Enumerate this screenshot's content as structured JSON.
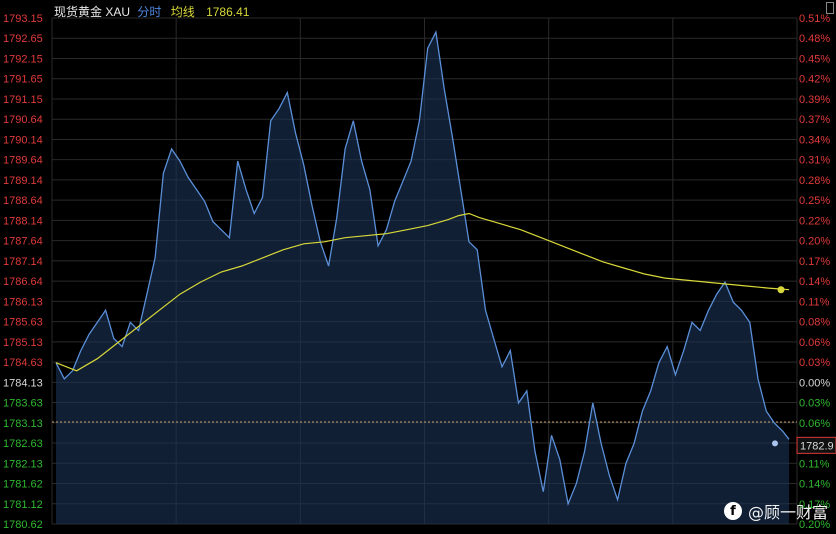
{
  "header": {
    "instrument": "现货黄金 XAU",
    "mode": "分时",
    "ma_label": "均线",
    "ma_value": "1786.41"
  },
  "colors": {
    "background": "#000000",
    "grid": "#2a2a2a",
    "price_line": "#5a8fd8",
    "area_fill": "#1a3357",
    "ma_line": "#d8d83a",
    "up_text": "#e03a3a",
    "down_text": "#2fb82f",
    "flat_text": "#d8d8d8",
    "ref_line": "#c9a26a"
  },
  "watermark": "@顾一财富",
  "chart_data": {
    "type": "line",
    "title": "",
    "xlabel": "",
    "ylabel": "",
    "ylim": [
      1780.6,
      1793.15
    ],
    "prev_close": 1784.13,
    "grid": true,
    "y_ticks_left": [
      "1793.15",
      "1792.65",
      "1792.15",
      "1791.65",
      "1791.15",
      "1790.64",
      "1790.14",
      "1789.64",
      "1789.14",
      "1788.64",
      "1788.14",
      "1787.64",
      "1787.14",
      "1786.64",
      "1786.13",
      "1785.63",
      "1785.13",
      "1784.63",
      "1784.13",
      "1783.63",
      "1783.13",
      "1782.63",
      "1782.13",
      "1781.62",
      "1781.12",
      "1780.62"
    ],
    "y_ticks_right": [
      "0.51%",
      "0.48%",
      "0.45%",
      "0.42%",
      "0.39%",
      "0.37%",
      "0.34%",
      "0.31%",
      "0.28%",
      "0.25%",
      "0.22%",
      "0.20%",
      "0.17%",
      "0.14%",
      "0.11%",
      "0.08%",
      "0.06%",
      "0.03%",
      "0.00%",
      "0.03%",
      "0.06%",
      "0.08%",
      "0.11%",
      "0.14%",
      "0.17%",
      "0.20%"
    ],
    "last_price_label": "1782.9",
    "series": [
      {
        "key": "price",
        "values": [
          [
            0,
            1784.6
          ],
          [
            8,
            1784.2
          ],
          [
            16,
            1784.4
          ],
          [
            24,
            1784.9
          ],
          [
            32,
            1785.3
          ],
          [
            40,
            1785.6
          ],
          [
            48,
            1785.9
          ],
          [
            56,
            1785.2
          ],
          [
            64,
            1785.0
          ],
          [
            72,
            1785.6
          ],
          [
            80,
            1785.4
          ],
          [
            88,
            1786.3
          ],
          [
            96,
            1787.2
          ],
          [
            104,
            1789.3
          ],
          [
            112,
            1789.9
          ],
          [
            120,
            1789.6
          ],
          [
            128,
            1789.2
          ],
          [
            136,
            1788.9
          ],
          [
            144,
            1788.6
          ],
          [
            152,
            1788.1
          ],
          [
            160,
            1787.9
          ],
          [
            168,
            1787.7
          ],
          [
            176,
            1789.6
          ],
          [
            184,
            1788.9
          ],
          [
            192,
            1788.3
          ],
          [
            200,
            1788.7
          ],
          [
            208,
            1790.6
          ],
          [
            216,
            1790.9
          ],
          [
            224,
            1791.3
          ],
          [
            232,
            1790.3
          ],
          [
            240,
            1789.5
          ],
          [
            248,
            1788.5
          ],
          [
            256,
            1787.6
          ],
          [
            264,
            1787.0
          ],
          [
            272,
            1788.2
          ],
          [
            280,
            1789.9
          ],
          [
            288,
            1790.6
          ],
          [
            296,
            1789.6
          ],
          [
            304,
            1788.9
          ],
          [
            312,
            1787.5
          ],
          [
            320,
            1787.9
          ],
          [
            328,
            1788.6
          ],
          [
            336,
            1789.1
          ],
          [
            344,
            1789.6
          ],
          [
            352,
            1790.6
          ],
          [
            360,
            1792.4
          ],
          [
            368,
            1792.8
          ],
          [
            376,
            1791.4
          ],
          [
            384,
            1790.2
          ],
          [
            392,
            1788.9
          ],
          [
            400,
            1787.6
          ],
          [
            408,
            1787.4
          ],
          [
            416,
            1785.9
          ],
          [
            424,
            1785.2
          ],
          [
            432,
            1784.5
          ],
          [
            440,
            1784.9
          ],
          [
            448,
            1783.6
          ],
          [
            456,
            1783.9
          ],
          [
            464,
            1782.4
          ],
          [
            472,
            1781.4
          ],
          [
            480,
            1782.8
          ],
          [
            488,
            1782.2
          ],
          [
            496,
            1781.1
          ],
          [
            504,
            1781.6
          ],
          [
            512,
            1782.4
          ],
          [
            520,
            1783.6
          ],
          [
            528,
            1782.6
          ],
          [
            536,
            1781.8
          ],
          [
            544,
            1781.2
          ],
          [
            552,
            1782.1
          ],
          [
            560,
            1782.6
          ],
          [
            568,
            1783.4
          ],
          [
            576,
            1783.9
          ],
          [
            584,
            1784.6
          ],
          [
            592,
            1785.0
          ],
          [
            600,
            1784.3
          ],
          [
            608,
            1784.9
          ],
          [
            616,
            1785.6
          ],
          [
            624,
            1785.4
          ],
          [
            632,
            1785.9
          ],
          [
            640,
            1786.3
          ],
          [
            648,
            1786.6
          ],
          [
            656,
            1786.1
          ],
          [
            664,
            1785.9
          ],
          [
            672,
            1785.6
          ],
          [
            680,
            1784.2
          ],
          [
            688,
            1783.4
          ],
          [
            696,
            1783.1
          ],
          [
            704,
            1782.9
          ],
          [
            710,
            1782.7
          ]
        ]
      },
      {
        "key": "average",
        "values": [
          [
            0,
            1784.6
          ],
          [
            20,
            1784.4
          ],
          [
            40,
            1784.7
          ],
          [
            60,
            1785.1
          ],
          [
            80,
            1785.5
          ],
          [
            100,
            1785.9
          ],
          [
            120,
            1786.3
          ],
          [
            140,
            1786.6
          ],
          [
            160,
            1786.85
          ],
          [
            180,
            1787.0
          ],
          [
            200,
            1787.2
          ],
          [
            220,
            1787.4
          ],
          [
            240,
            1787.55
          ],
          [
            260,
            1787.6
          ],
          [
            280,
            1787.7
          ],
          [
            300,
            1787.75
          ],
          [
            320,
            1787.8
          ],
          [
            340,
            1787.9
          ],
          [
            360,
            1788.0
          ],
          [
            380,
            1788.15
          ],
          [
            390,
            1788.25
          ],
          [
            400,
            1788.3
          ],
          [
            410,
            1788.2
          ],
          [
            430,
            1788.05
          ],
          [
            450,
            1787.9
          ],
          [
            470,
            1787.7
          ],
          [
            490,
            1787.5
          ],
          [
            510,
            1787.3
          ],
          [
            530,
            1787.1
          ],
          [
            550,
            1786.95
          ],
          [
            570,
            1786.8
          ],
          [
            590,
            1786.7
          ],
          [
            610,
            1786.65
          ],
          [
            630,
            1786.6
          ],
          [
            650,
            1786.55
          ],
          [
            670,
            1786.5
          ],
          [
            690,
            1786.45
          ],
          [
            700,
            1786.43
          ],
          [
            710,
            1786.41
          ]
        ]
      }
    ]
  }
}
